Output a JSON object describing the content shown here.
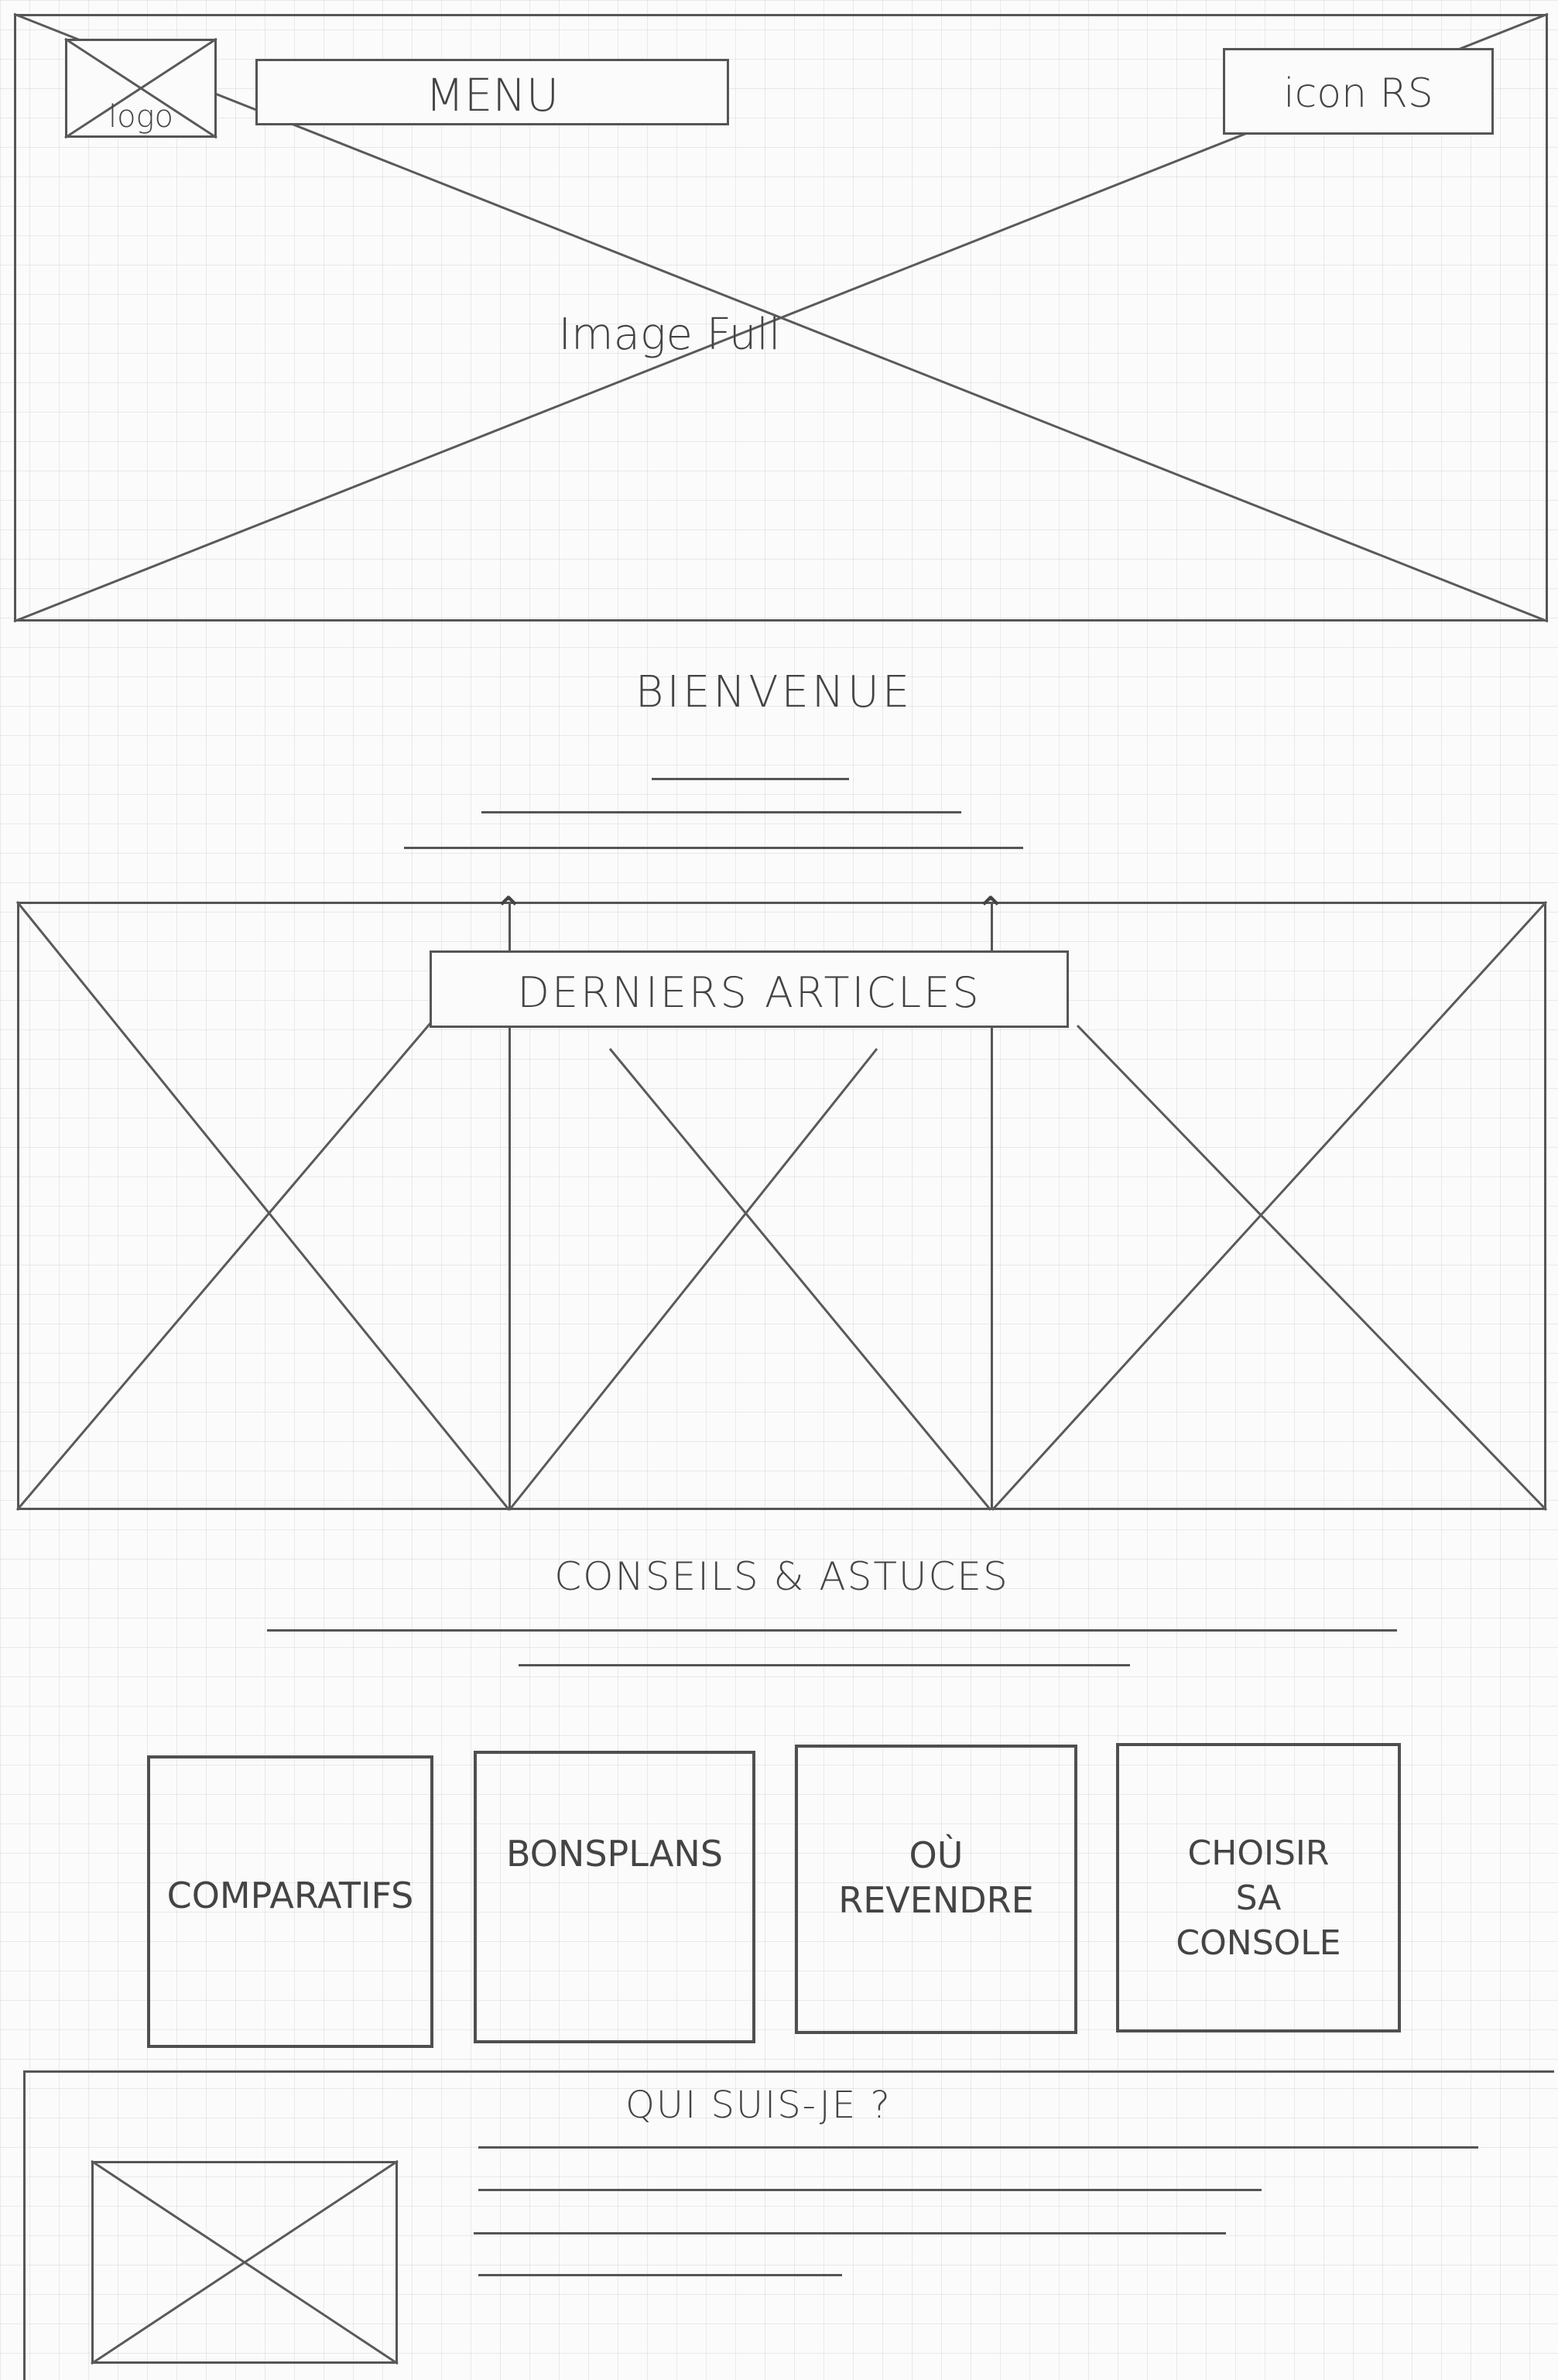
{
  "header": {
    "logo_label": "logo",
    "menu_label": "MENU",
    "social_label": "icon RS",
    "hero_label": "Image Full"
  },
  "welcome": {
    "title": "BIENVENUE"
  },
  "articles": {
    "title": "DERNIERS ARTICLES"
  },
  "tips": {
    "title": "CONSEILS & ASTUCES",
    "cards": [
      {
        "label": "COMPARATIFS"
      },
      {
        "label": "BONSPLANS"
      },
      {
        "label": "OÙ\nREVENDRE"
      },
      {
        "label": "CHOISIR\nSA\nCONSOLE"
      }
    ]
  },
  "about": {
    "title": "QUI SUIS-JE ?"
  }
}
